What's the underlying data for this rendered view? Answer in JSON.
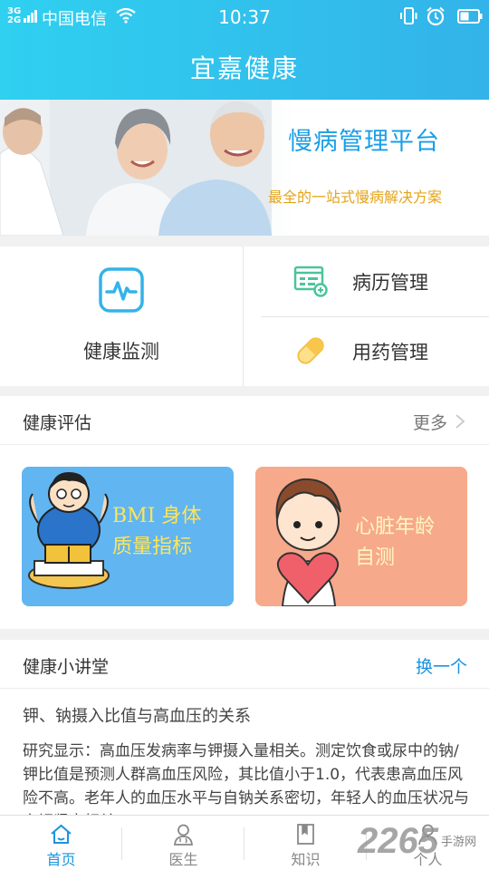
{
  "status_bar": {
    "network": "3G\n2G",
    "carrier": "中国电信",
    "time": "10:37"
  },
  "header": {
    "title": "宜嘉健康"
  },
  "banner": {
    "title": "慢病管理平台",
    "subtitle": "最全的一站式慢病解决方案"
  },
  "quick_actions": {
    "monitor_label": "健康监测",
    "records_label": "病历管理",
    "medication_label": "用药管理"
  },
  "assessment": {
    "title": "健康评估",
    "more_label": "更多",
    "cards": [
      {
        "line1": "BMI 身体",
        "line2": "质量指标"
      },
      {
        "line1": "心脏年龄",
        "line2": "自测"
      }
    ]
  },
  "lecture": {
    "title": "健康小讲堂",
    "swap_label": "换一个",
    "headline": "钾、钠摄入比值与高血压的关系",
    "body": "研究显示：高血压发病率与钾摄入量相关。测定饮食或尿中的钠/钾比值是预测人群高血压风险，其比值小于1.0，代表患高血压风险不高。老年人的血压水平与自钠关系密切，年轻人的血压状况与血钾紧密相关。"
  },
  "tabbar": {
    "tabs": [
      {
        "label": "首页",
        "icon": "home-icon",
        "active": true
      },
      {
        "label": "医生",
        "icon": "doctor-icon",
        "active": false
      },
      {
        "label": "知识",
        "icon": "book-icon",
        "active": false
      },
      {
        "label": "个人",
        "icon": "person-icon",
        "active": false
      }
    ]
  },
  "watermark": {
    "big": "2265",
    "small": "手游网"
  },
  "colors": {
    "header_start": "#2fd0f0",
    "header_end": "#33b3e9",
    "accent_blue": "#1a94e0",
    "banner_subtitle": "#e4a41b",
    "bmi_card": "#61b5f0",
    "heart_card": "#f7a98b"
  }
}
